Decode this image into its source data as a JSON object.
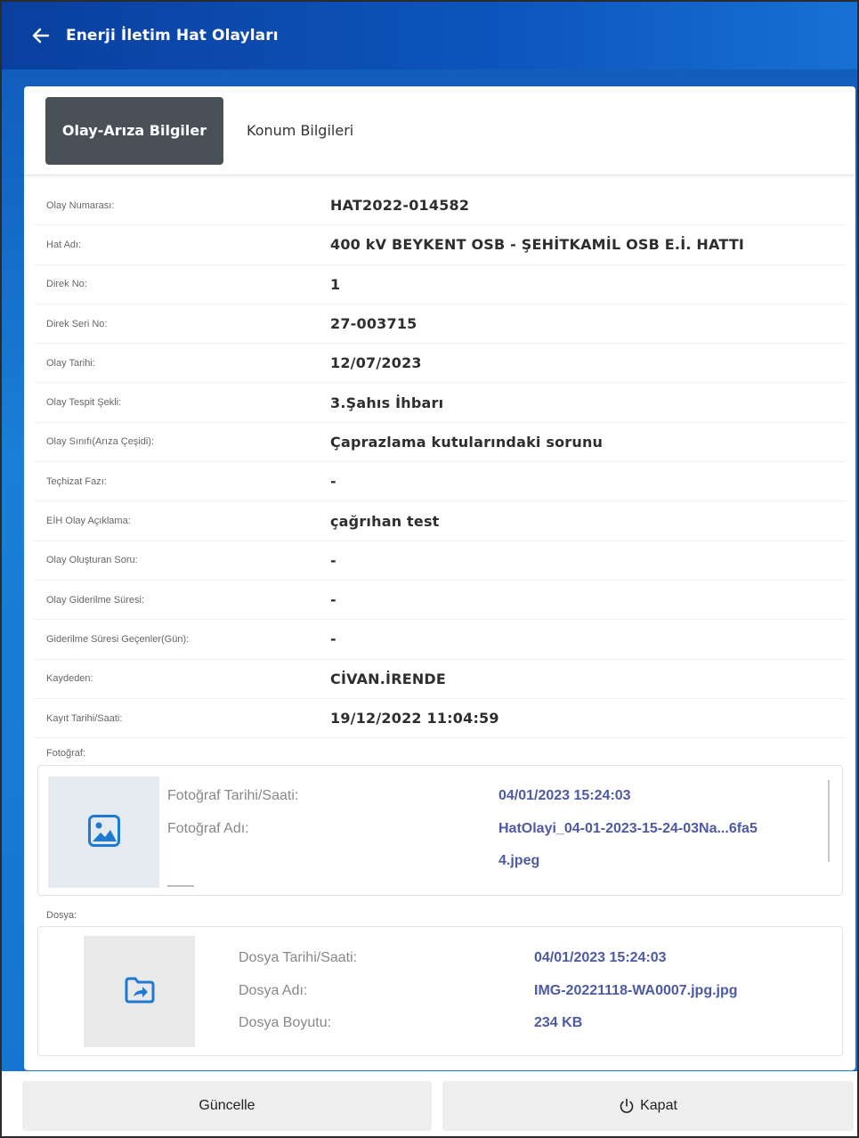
{
  "header": {
    "title": "Enerji İletim Hat Olayları",
    "back_icon": "arrow-left-icon"
  },
  "tabs": [
    {
      "label": "Olay-Arıza Bilgiler",
      "active": true
    },
    {
      "label": "Konum Bilgileri",
      "active": false
    }
  ],
  "details": [
    {
      "label": "Olay Numarası:",
      "value": "HAT2022-014582"
    },
    {
      "label": "Hat Adı:",
      "value": "400 kV BEYKENT OSB - ŞEHİTKAMİL OSB E.İ. HATTI"
    },
    {
      "label": "Direk No:",
      "value": "1"
    },
    {
      "label": "Direk Seri No:",
      "value": "27-003715"
    },
    {
      "label": "Olay Tarihi:",
      "value": "12/07/2023"
    },
    {
      "label": "Olay Tespit Şekli:",
      "value": "3.Şahıs İhbarı"
    },
    {
      "label": "Olay Sınıfı(Arıza Çeşidi):",
      "value": "Çaprazlama kutularındaki sorunu"
    },
    {
      "label": "Teçhizat Fazı:",
      "value": "-"
    },
    {
      "label": "EİH Olay Açıklama:",
      "value": "çağrıhan test"
    },
    {
      "label": "Olay Oluşturan Soru:",
      "value": "-"
    },
    {
      "label": "Olay Giderilme Süresi:",
      "value": "-"
    },
    {
      "label": "Giderilme Süresi Geçenler(Gün):",
      "value": "-"
    },
    {
      "label": "Kaydeden:",
      "value": "CİVAN.İRENDE"
    },
    {
      "label": "Kayıt Tarihi/Saati:",
      "value": "19/12/2022 11:04:59"
    }
  ],
  "photo": {
    "section_label": "Fotoğraf:",
    "icon": "image-icon",
    "date_label": "Fotoğraf Tarihi/Saati:",
    "date_value": "04/01/2023 15:24:03",
    "name_label": "Fotoğraf Adı:",
    "name_value_line1": "HatOlayi_04-01-2023-15-24-03Na...6fa5",
    "name_value_line2": "4.jpeg"
  },
  "file": {
    "section_label": "Dosya:",
    "icon": "folder-share-icon",
    "date_label": "Dosya Tarihi/Saati:",
    "date_value": "04/01/2023 15:24:03",
    "name_label": "Dosya Adı:",
    "name_value": "IMG-20221118-WA0007.jpg.jpg",
    "size_label": "Dosya Boyutu:",
    "size_value": "234 KB"
  },
  "footer": {
    "update_label": "Güncelle",
    "close_label": "Kapat",
    "close_icon": "power-icon"
  },
  "colors": {
    "header": "#0d56be",
    "active_tab": "#495057",
    "link_value": "#4d5aa4"
  }
}
